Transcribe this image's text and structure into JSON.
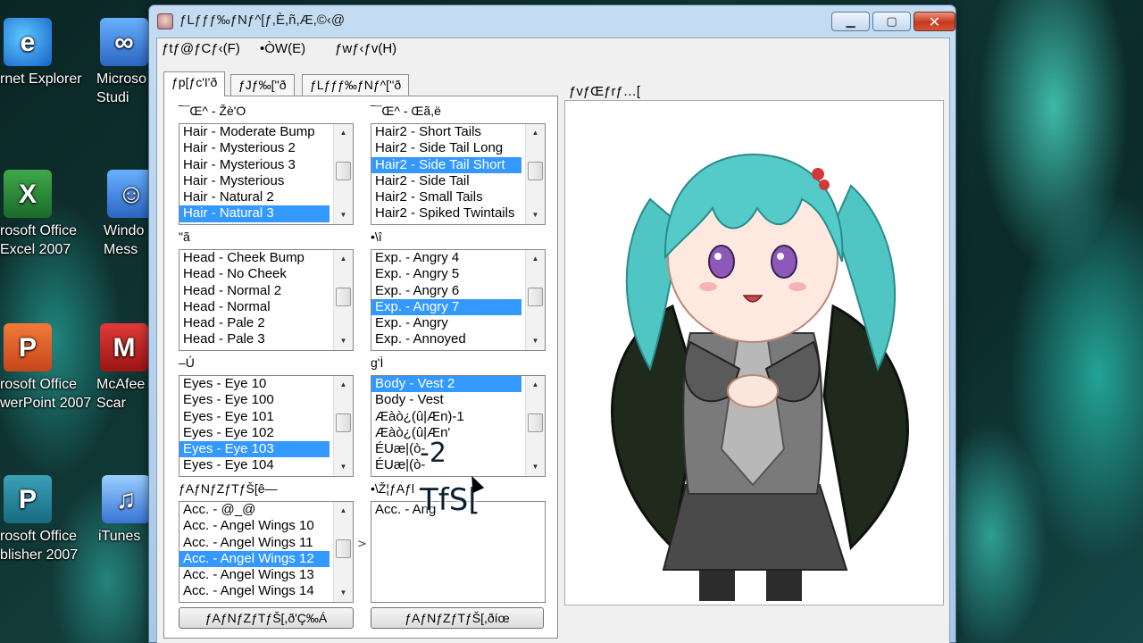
{
  "desktop": {
    "icons": [
      {
        "label": "rnet Explorer",
        "icon": "internet-explorer-icon"
      },
      {
        "label": "Microso Studi",
        "icon": "visual-studio-icon"
      },
      {
        "label": "rosoft Office Excel 2007",
        "icon": "excel-icon"
      },
      {
        "label": "Windo Mess",
        "icon": "windows-messenger-icon"
      },
      {
        "label": "rosoft Office werPoint 2007",
        "icon": "powerpoint-icon"
      },
      {
        "label": "McAfee Scar",
        "icon": "mcafee-icon"
      },
      {
        "label": "rosoft Office blisher 2007",
        "icon": "publisher-icon"
      },
      {
        "label": "iTunes",
        "icon": "itunes-icon"
      }
    ]
  },
  "window": {
    "title": "ƒLƒƒƒ‰ƒNƒ^[ƒ,È,ñ,Æ,©‹@",
    "caption": {
      "minimize": "▁",
      "maximize": "▢",
      "close": "✕"
    }
  },
  "menu": {
    "file": "ƒtƒ@ƒCƒ‹(F)",
    "edit": "•ÒW(E)",
    "help": "ƒwƒ‹ƒv(H)"
  },
  "tabs": [
    "ƒp[ƒc'I'ð",
    "ƒJƒ‰[''ð",
    "ƒLƒƒƒ‰ƒNƒ^[''ð"
  ],
  "parts": {
    "hair_front": {
      "label": "‾¯Œ^ - Žè'O",
      "items": [
        "Hair - Moderate Bump",
        "Hair - Mysterious 2",
        "Hair - Mysterious 3",
        "Hair - Mysterious",
        "Hair - Natural 2",
        "Hair - Natural 3"
      ],
      "selected": 5
    },
    "hair_back": {
      "label": "‾¯Œ^ - Œã,ë",
      "items": [
        "Hair2 - Short Tails",
        "Hair2 - Side Tail Long",
        "Hair2 - Side Tail Short",
        "Hair2 - Side Tail",
        "Hair2 - Small Tails",
        "Hair2 - Spiked Twintails"
      ],
      "selected": 2
    },
    "face": {
      "label": "\"ã",
      "items": [
        "Head - Cheek Bump",
        "Head - No Cheek",
        "Head - Normal 2",
        "Head - Normal",
        "Head - Pale 2",
        "Head - Pale 3"
      ],
      "selected": -1
    },
    "expression": {
      "label": "•\\î",
      "items": [
        "Exp. - Angry 4",
        "Exp. - Angry 5",
        "Exp. - Angry 6",
        "Exp. - Angry 7",
        "Exp. - Angry",
        "Exp. - Annoyed"
      ],
      "selected": 3
    },
    "eyes": {
      "label": "–Ú",
      "items": [
        "Eyes - Eye 10",
        "Eyes - Eye 100",
        "Eyes - Eye 101",
        "Eyes - Eye 102",
        "Eyes - Eye 103",
        "Eyes - Eye 104"
      ],
      "selected": 4
    },
    "body": {
      "label": "g'Ì",
      "items": [
        "Body - Vest 2",
        "Body - Vest",
        "Æàò¿(û|Æn)-1",
        "Æàò¿(û|Æn'",
        "ÉUæ|(ò-",
        "ÉUæ|(ò-"
      ],
      "selected": 0
    },
    "accessory": {
      "label": "ƒAƒNƒZƒTƒŠ[ê—",
      "items": [
        "Acc. - @_@",
        "Acc. - Angel Wings 10",
        "Acc. - Angel Wings 11",
        "Acc. - Angel Wings 12",
        "Acc. - Angel Wings 13",
        "Acc. - Angel Wings 14"
      ],
      "selected": 3
    },
    "equipped": {
      "label": "•\\Ž¦ƒAƒl",
      "items": [
        "Acc. - Ang"
      ],
      "selected": -1
    }
  },
  "arrow": ">",
  "buttons": {
    "add_accessory": "ƒAƒNƒZƒTƒŠ[,ð'Ç‰Á",
    "remove_accessory": "ƒAƒNƒZƒTƒŠ[,ðíœ"
  },
  "preview": {
    "label": "ƒvƒŒƒrƒ…["
  },
  "overlay": {
    "line1": "-2",
    "line2": "TfS["
  }
}
